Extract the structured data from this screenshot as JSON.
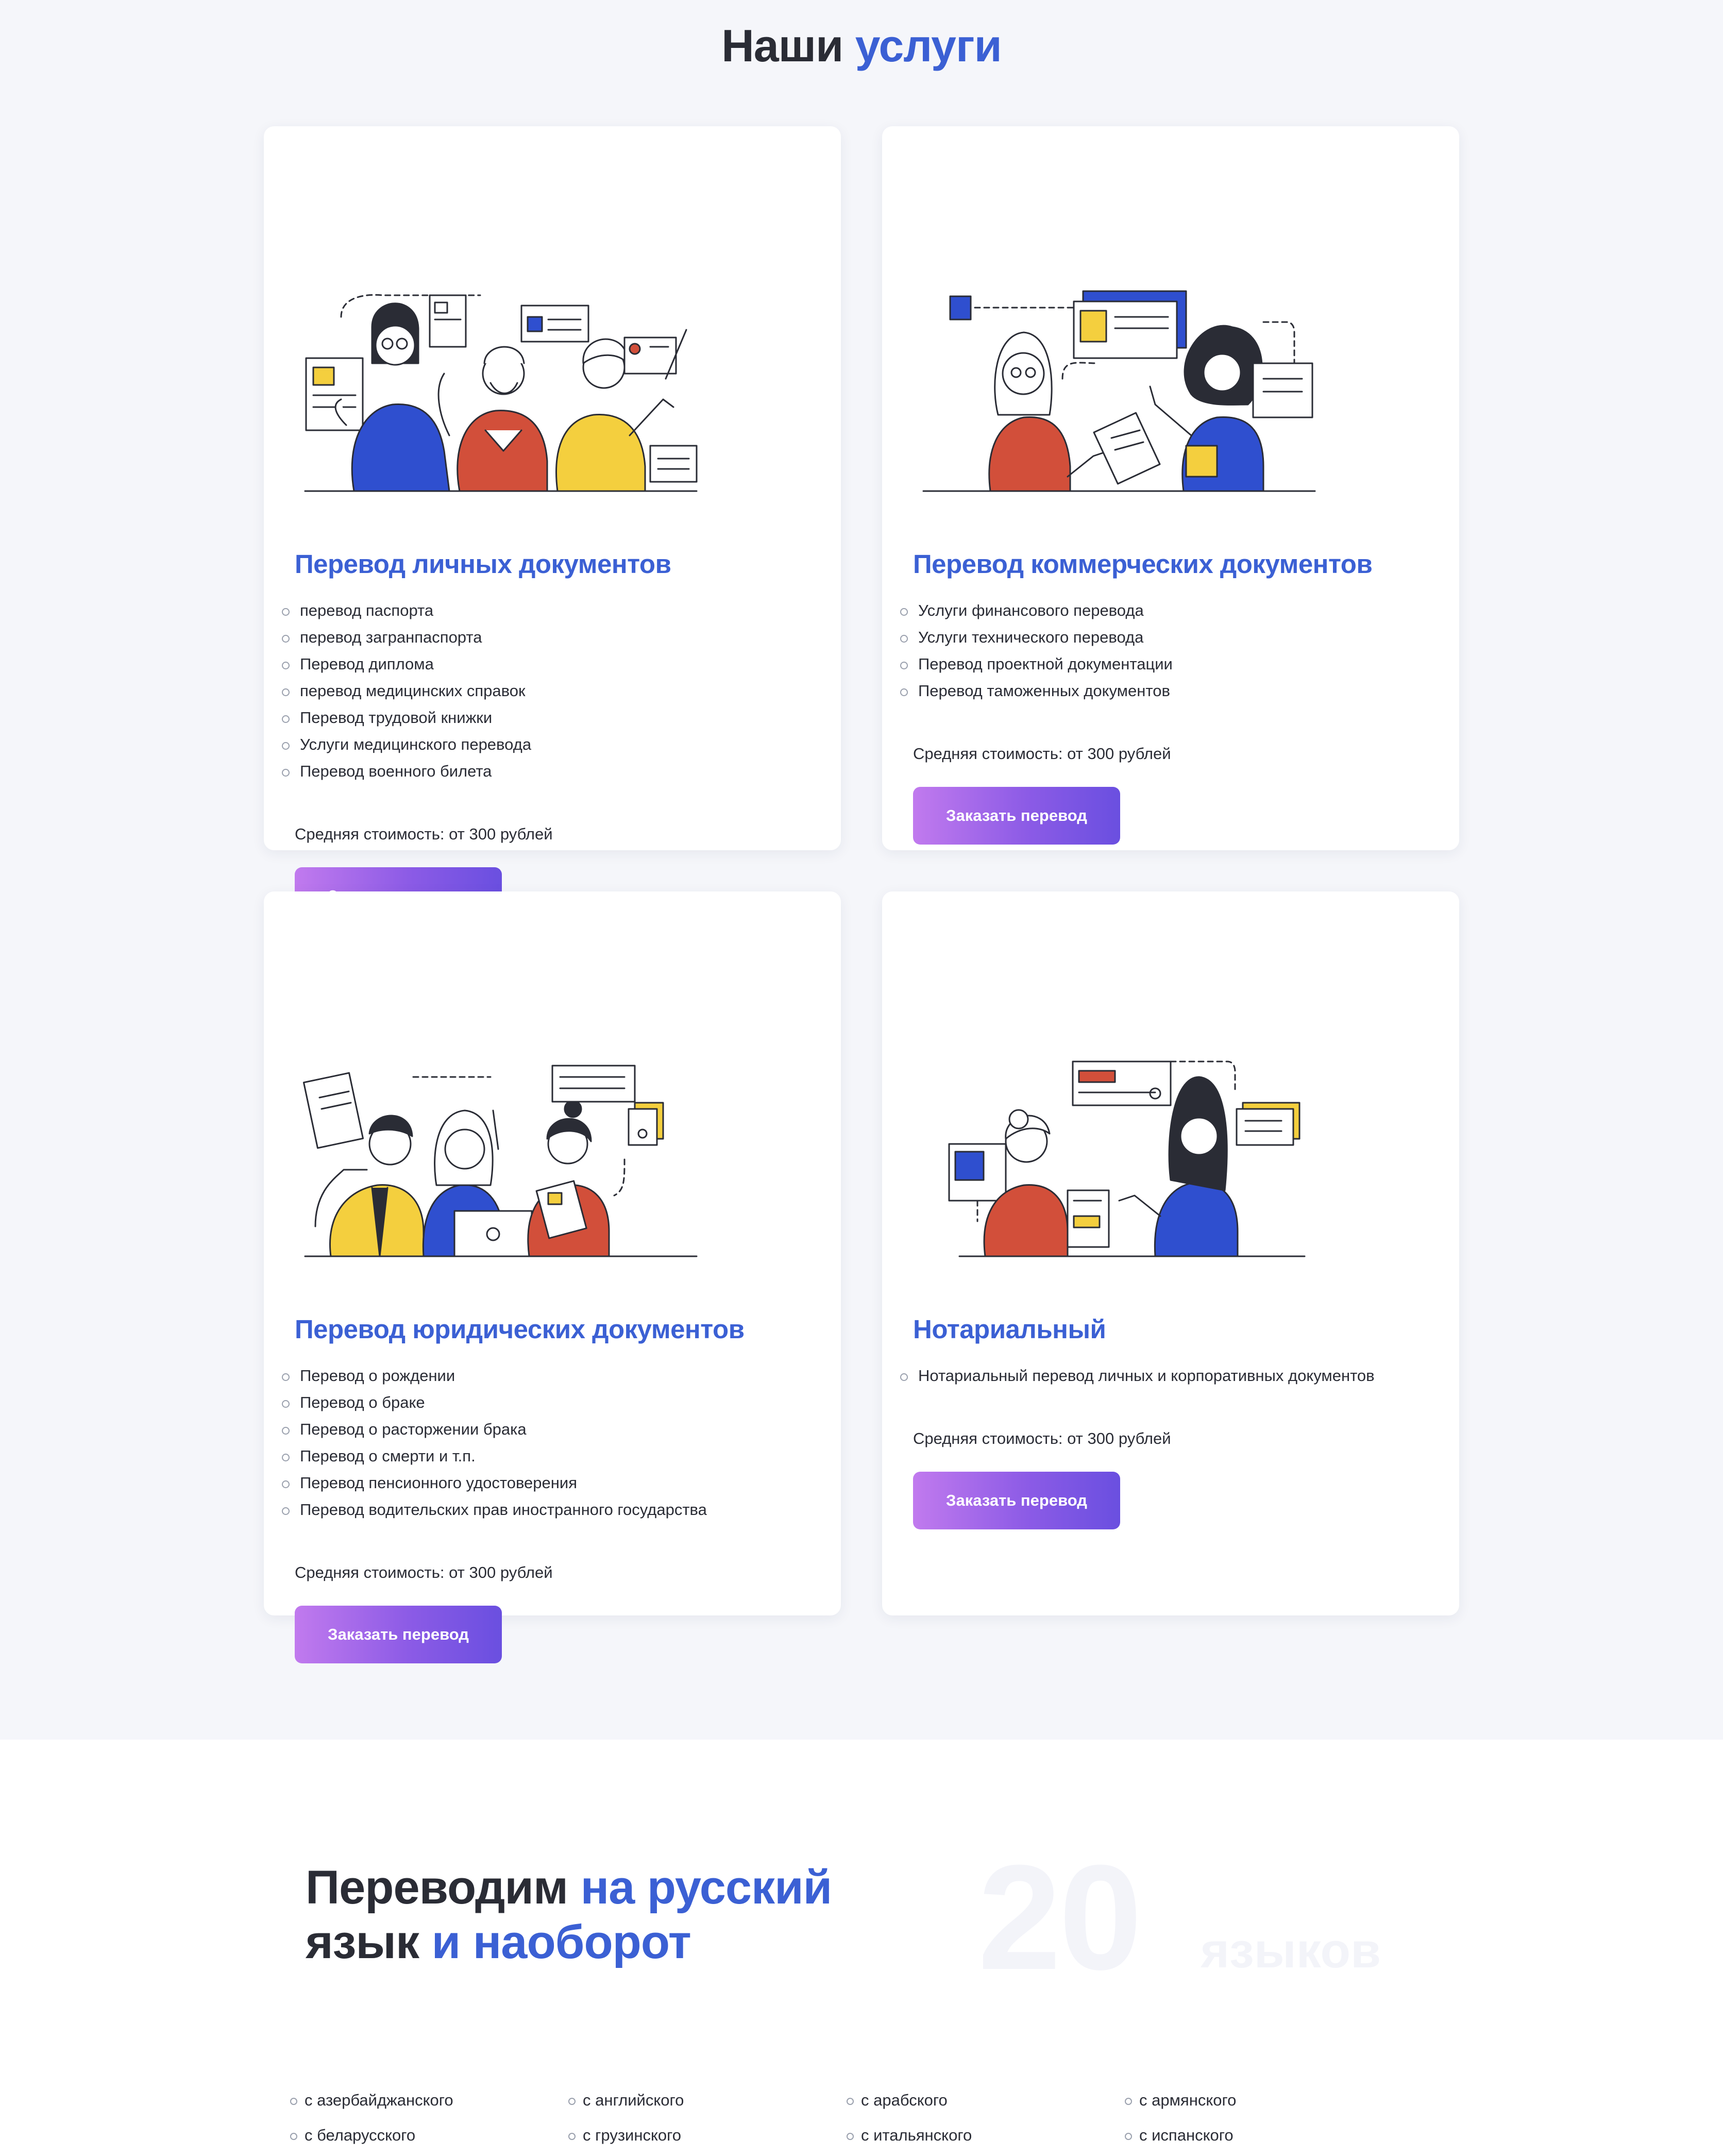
{
  "services": {
    "title_part1": "Наши",
    "title_part2": "услуги",
    "cards": [
      {
        "title": "Перевод личных документов",
        "items": [
          "перевод паспорта",
          "перевод загранпаспорта",
          "Перевод диплома",
          "перевод медицинских справок",
          "Перевод трудовой книжки",
          "Услуги медицинского перевода",
          "Перевод военного билета"
        ],
        "price": "Средняя стоимость: от 300 рублей",
        "button": "Заказать перевод"
      },
      {
        "title": "Перевод коммерческих документов",
        "items": [
          "Услуги финансового перевода",
          "Услуги технического перевода",
          "Перевод проектной документации",
          "Перевод таможенных документов"
        ],
        "price": "Средняя стоимость: от 300 рублей",
        "button": "Заказать перевод"
      },
      {
        "title": "Перевод юридических документов",
        "items": [
          "Перевод о рождении",
          "Перевод о браке",
          "Перевод о расторжении брака",
          "Перевод о смерти и т.п.",
          "Перевод пенсионного удостоверения",
          "Перевод водительских прав иностранного государства"
        ],
        "price": "Средняя стоимость: от 300 рублей",
        "button": "Заказать перевод"
      },
      {
        "title": "Нотариальный",
        "items": [
          "Нотариальный перевод личных и корпоративных документов"
        ],
        "price": "Средняя стоимость: от 300 рублей",
        "button": "Заказать перевод"
      }
    ]
  },
  "languages": {
    "heading_line1_a": "Переводим",
    "heading_line1_b": "на русский",
    "heading_line2_a": "язык",
    "heading_line2_b": "и наоборот",
    "count": "20",
    "count_unit": "языков",
    "items": [
      "с азербайджанского",
      "с английского",
      "с арабского",
      "с армянского",
      "с беларусского",
      "с грузинского",
      "с итальянского",
      "с испанского"
    ]
  },
  "colors": {
    "accent": "#3b60d4",
    "background": "#f5f6fa",
    "button_gradient_start": "#c17aee",
    "button_gradient_end": "#6a4fe0",
    "illustration_blue": "#2f4fcf",
    "illustration_red": "#d24f3a",
    "illustration_yellow": "#f4cf3e"
  }
}
